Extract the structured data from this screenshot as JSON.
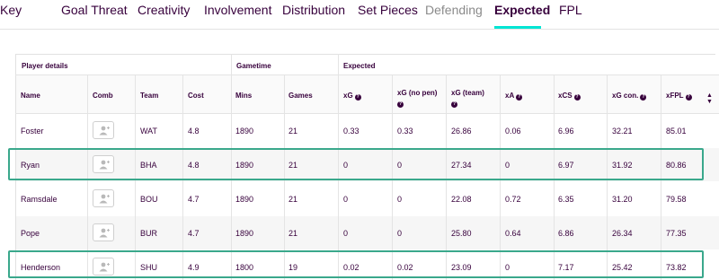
{
  "tabs": [
    {
      "label": "Key",
      "state": "normal"
    },
    {
      "label": "Goal Threat",
      "state": "normal"
    },
    {
      "label": "Creativity",
      "state": "normal"
    },
    {
      "label": "Involvement",
      "state": "normal"
    },
    {
      "label": "Distribution",
      "state": "normal"
    },
    {
      "label": "Set Pieces",
      "state": "normal"
    },
    {
      "label": "Defending",
      "state": "muted"
    },
    {
      "label": "Expected",
      "state": "active"
    },
    {
      "label": "FPL",
      "state": "normal"
    }
  ],
  "groups": {
    "player_details": "Player details",
    "gametime": "Gametime",
    "expected": "Expected"
  },
  "columns": {
    "name": "Name",
    "comb": "Comb",
    "team": "Team",
    "cost": "Cost",
    "mins": "Mins",
    "games": "Games",
    "xg": "xG",
    "xg_no_pen": "xG (no pen)",
    "xg_team": "xG (team)",
    "xa": "xA",
    "xcs": "xCS",
    "xg_con": "xG con.",
    "xfpl": "xFPL"
  },
  "rows": [
    {
      "name": "Foster",
      "team": "WAT",
      "cost": "4.8",
      "mins": "1890",
      "games": "21",
      "xg": "0.33",
      "xg_no_pen": "0.33",
      "xg_team": "26.86",
      "xa": "0.06",
      "xcs": "6.96",
      "xg_con": "32.21",
      "xfpl": "85.01",
      "highlighted": false
    },
    {
      "name": "Ryan",
      "team": "BHA",
      "cost": "4.8",
      "mins": "1890",
      "games": "21",
      "xg": "0",
      "xg_no_pen": "0",
      "xg_team": "27.34",
      "xa": "0",
      "xcs": "6.97",
      "xg_con": "31.92",
      "xfpl": "80.86",
      "highlighted": true
    },
    {
      "name": "Ramsdale",
      "team": "BOU",
      "cost": "4.7",
      "mins": "1890",
      "games": "21",
      "xg": "0",
      "xg_no_pen": "0",
      "xg_team": "22.08",
      "xa": "0.72",
      "xcs": "6.35",
      "xg_con": "31.20",
      "xfpl": "79.58",
      "highlighted": false
    },
    {
      "name": "Pope",
      "team": "BUR",
      "cost": "4.7",
      "mins": "1890",
      "games": "21",
      "xg": "0",
      "xg_no_pen": "0",
      "xg_team": "25.80",
      "xa": "0.64",
      "xcs": "6.86",
      "xg_con": "26.34",
      "xfpl": "77.35",
      "highlighted": false
    },
    {
      "name": "Henderson",
      "team": "SHU",
      "cost": "4.9",
      "mins": "1800",
      "games": "19",
      "xg": "0.02",
      "xg_no_pen": "0.02",
      "xg_team": "23.09",
      "xa": "0",
      "xcs": "7.17",
      "xg_con": "25.42",
      "xfpl": "73.82",
      "highlighted": true
    }
  ],
  "colors": {
    "text": "#37003c",
    "accent": "#00e5d4",
    "highlight_border": "#3aa88c",
    "muted": "#8a8a8a"
  },
  "icons": {
    "comb": "add-user-icon",
    "help": "question-icon",
    "sort": "sort-arrow-icon"
  }
}
